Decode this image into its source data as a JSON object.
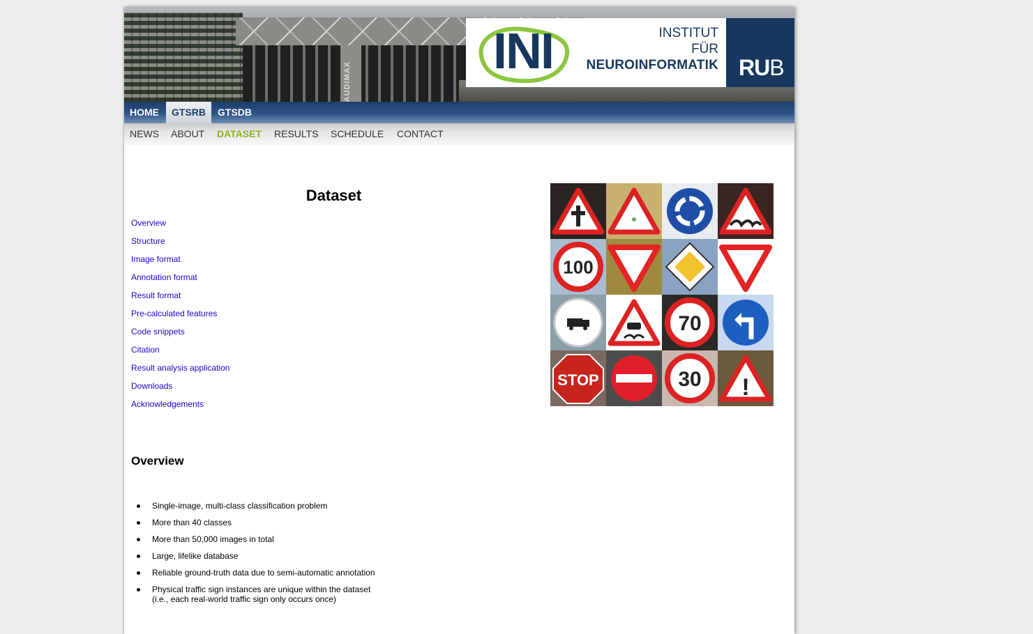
{
  "logo": {
    "institute_line1": "INSTITUT",
    "institute_line2": "FÜR",
    "institute_line3": "NEUROINFORMATIK",
    "ini_letters": "INI",
    "rub_bold": "RU",
    "rub_light": "B",
    "building_label": "AUDIMAX",
    "colors": {
      "navy": "#17375e",
      "green": "#8cc63f"
    }
  },
  "top_nav": {
    "items": [
      "HOME",
      "GTSRB",
      "GTSDB"
    ],
    "active": "GTSRB"
  },
  "sub_nav": {
    "items": [
      "NEWS",
      "ABOUT",
      "DATASET",
      "RESULTS",
      "SCHEDULE",
      "CONTACT"
    ],
    "active": "DATASET",
    "active_color": "#8ab31e"
  },
  "main": {
    "title": "Dataset",
    "toc": [
      "Overview",
      "Structure",
      "Image format",
      "Annotation format",
      "Result format",
      "Pre-calculated features",
      "Code snippets",
      "Citation",
      "Result analysis application",
      "Downloads",
      "Acknowledgements"
    ],
    "overview_title": "Overview",
    "overview_bullets": [
      [
        "Single-image, multi-class classification problem"
      ],
      [
        "More than 40 classes"
      ],
      [
        "More than 50,000 images in total"
      ],
      [
        "Large, lifelike database"
      ],
      [
        "Reliable ground-truth data due to semi-automatic annotation"
      ],
      [
        "Physical traffic sign instances are unique within the dataset",
        "(i.e., each real-world traffic sign only occurs once)"
      ]
    ]
  },
  "sign_grid": {
    "tiles": [
      {
        "icon": "priority-crossroad-warning-sign-icon",
        "bg": "#2a2420"
      },
      {
        "icon": "warning-triangle-sign-icon",
        "bg": "#c8b070"
      },
      {
        "icon": "roundabout-sign-icon",
        "bg": "#e9edf0"
      },
      {
        "icon": "uneven-road-warning-sign-icon",
        "bg": "#3a2520"
      },
      {
        "icon": "speed-limit-100-sign-icon",
        "bg": "#a9bcd0",
        "text": "100"
      },
      {
        "icon": "yield-sign-icon",
        "bg": "#a08a40"
      },
      {
        "icon": "priority-road-sign-icon",
        "bg": "#8aa2c4"
      },
      {
        "icon": "yield-sign-icon",
        "bg": "#ffffff"
      },
      {
        "icon": "no-trucks-sign-icon",
        "bg": "#8c9ea8"
      },
      {
        "icon": "slippery-road-sign-icon",
        "bg": "#ffffff"
      },
      {
        "icon": "speed-limit-70-sign-icon",
        "bg": "#2a2a26",
        "text": "70"
      },
      {
        "icon": "turn-left-mandatory-sign-icon",
        "bg": "#c8d8f0"
      },
      {
        "icon": "stop-sign-icon",
        "bg": "#7a6a62",
        "text": "STOP"
      },
      {
        "icon": "no-entry-sign-icon",
        "bg": "#4c4c4c"
      },
      {
        "icon": "speed-limit-30-sign-icon",
        "bg": "#c8b8b0",
        "text": "30"
      },
      {
        "icon": "general-caution-sign-icon",
        "bg": "#6b5a3c",
        "text": "!"
      }
    ]
  }
}
